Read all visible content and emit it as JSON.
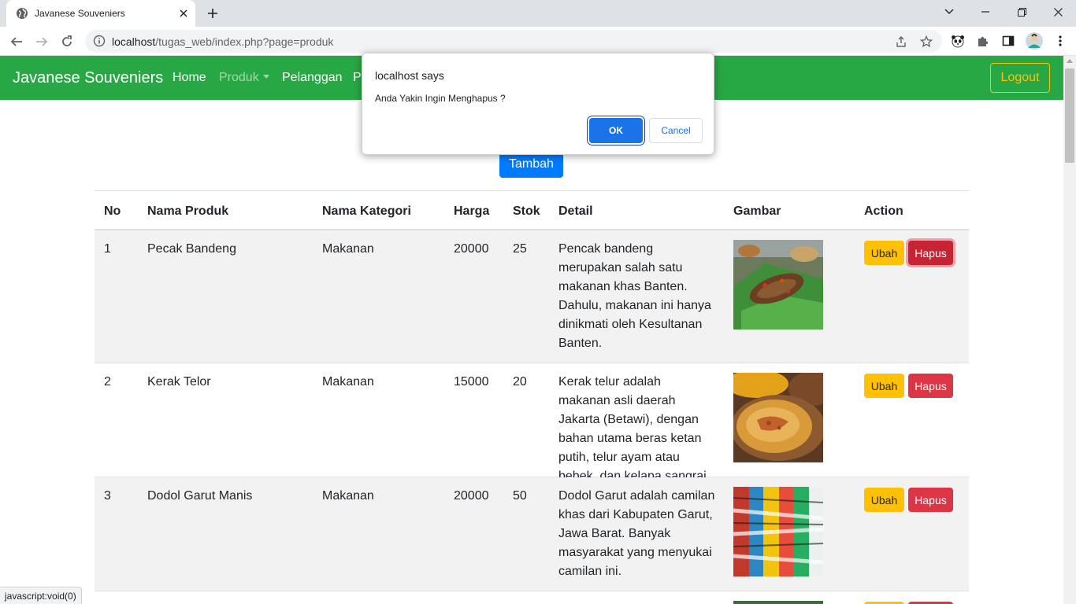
{
  "browser": {
    "tab_title": "Javanese Souveniers",
    "url_host": "localhost",
    "url_path": "/tugas_web/index.php?page=produk",
    "status_text": "javascript:void(0)"
  },
  "navbar": {
    "brand": "Javanese Souveniers",
    "links": [
      "Home",
      "Produk",
      "Pelanggan",
      "Pe"
    ],
    "logout": "Logout"
  },
  "main": {
    "add_button": "Tambah",
    "table": {
      "headers": [
        "No",
        "Nama Produk",
        "Nama Kategori",
        "Harga",
        "Stok",
        "Detail",
        "Gambar",
        "Action"
      ],
      "rows": [
        {
          "no": "1",
          "nama": "Pecak Bandeng",
          "kategori": "Makanan",
          "harga": "20000",
          "stok": "25",
          "detail": "Pencak bandeng merupakan salah satu makanan khas Banten. Dahulu, makanan ini hanya dinikmati oleh Kesultanan Banten.",
          "ubah": "Ubah",
          "hapus": "Hapus"
        },
        {
          "no": "2",
          "nama": "Kerak Telor",
          "kategori": "Makanan",
          "harga": "15000",
          "stok": "20",
          "detail": "Kerak telur adalah makanan asli daerah Jakarta (Betawi), dengan bahan utama beras ketan putih, telur ayam atau bebek, dan kelapa sangrai.",
          "ubah": "Ubah",
          "hapus": "Hapus"
        },
        {
          "no": "3",
          "nama": "Dodol Garut Manis",
          "kategori": "Makanan",
          "harga": "20000",
          "stok": "50",
          "detail": "Dodol Garut adalah camilan khas dari Kabupaten Garut, Jawa Barat. Banyak masyarakat yang menyukai camilan ini.",
          "ubah": "Ubah",
          "hapus": "Hapus"
        }
      ]
    }
  },
  "dialog": {
    "title": "localhost says",
    "message": "Anda Yakin Ingin Menghapus ?",
    "ok": "OK",
    "cancel": "Cancel"
  },
  "colors": {
    "navbar": "#28a745",
    "primary": "#007bff",
    "warning": "#ffc107",
    "danger": "#dc3545"
  }
}
